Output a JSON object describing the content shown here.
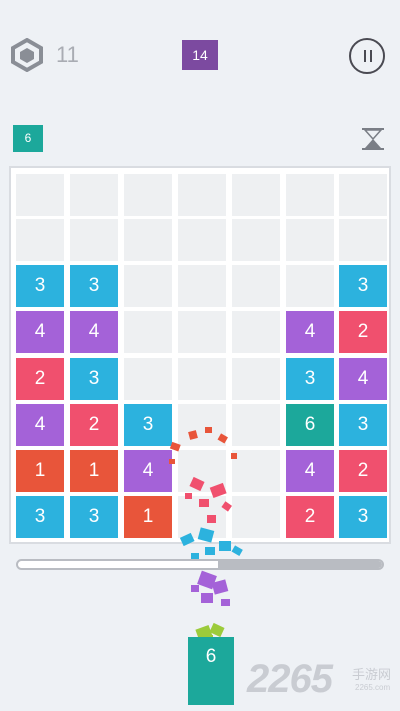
{
  "header": {
    "gem_count": "11",
    "level": "14",
    "next_tile": "6"
  },
  "colors": {
    "1": "#e8553a",
    "2": "#f0506e",
    "3": "#2cb2de",
    "4": "#a462d8",
    "6": "#1ca89b"
  },
  "board": {
    "columns": 7,
    "rows": 8,
    "tiles": [
      {
        "row": 2,
        "col": 0,
        "value": "3"
      },
      {
        "row": 2,
        "col": 1,
        "value": "3"
      },
      {
        "row": 2,
        "col": 6,
        "value": "3"
      },
      {
        "row": 3,
        "col": 0,
        "value": "4"
      },
      {
        "row": 3,
        "col": 1,
        "value": "4"
      },
      {
        "row": 3,
        "col": 5,
        "value": "4"
      },
      {
        "row": 3,
        "col": 6,
        "value": "2"
      },
      {
        "row": 4,
        "col": 0,
        "value": "2"
      },
      {
        "row": 4,
        "col": 1,
        "value": "3"
      },
      {
        "row": 4,
        "col": 5,
        "value": "3"
      },
      {
        "row": 4,
        "col": 6,
        "value": "4"
      },
      {
        "row": 5,
        "col": 0,
        "value": "4"
      },
      {
        "row": 5,
        "col": 1,
        "value": "2"
      },
      {
        "row": 5,
        "col": 2,
        "value": "3"
      },
      {
        "row": 5,
        "col": 5,
        "value": "6"
      },
      {
        "row": 5,
        "col": 6,
        "value": "3"
      },
      {
        "row": 6,
        "col": 0,
        "value": "1"
      },
      {
        "row": 6,
        "col": 1,
        "value": "1"
      },
      {
        "row": 6,
        "col": 2,
        "value": "4"
      },
      {
        "row": 6,
        "col": 5,
        "value": "4"
      },
      {
        "row": 6,
        "col": 6,
        "value": "2"
      },
      {
        "row": 7,
        "col": 0,
        "value": "3"
      },
      {
        "row": 7,
        "col": 1,
        "value": "3"
      },
      {
        "row": 7,
        "col": 2,
        "value": "1"
      },
      {
        "row": 7,
        "col": 5,
        "value": "2"
      },
      {
        "row": 7,
        "col": 6,
        "value": "3"
      }
    ],
    "falling_tile": {
      "col": 3,
      "value": "6"
    }
  },
  "progress": {
    "filled_fraction": 0.55
  },
  "watermark": {
    "brand": "2265",
    "sub": "手游网",
    "url": "2265.com"
  }
}
